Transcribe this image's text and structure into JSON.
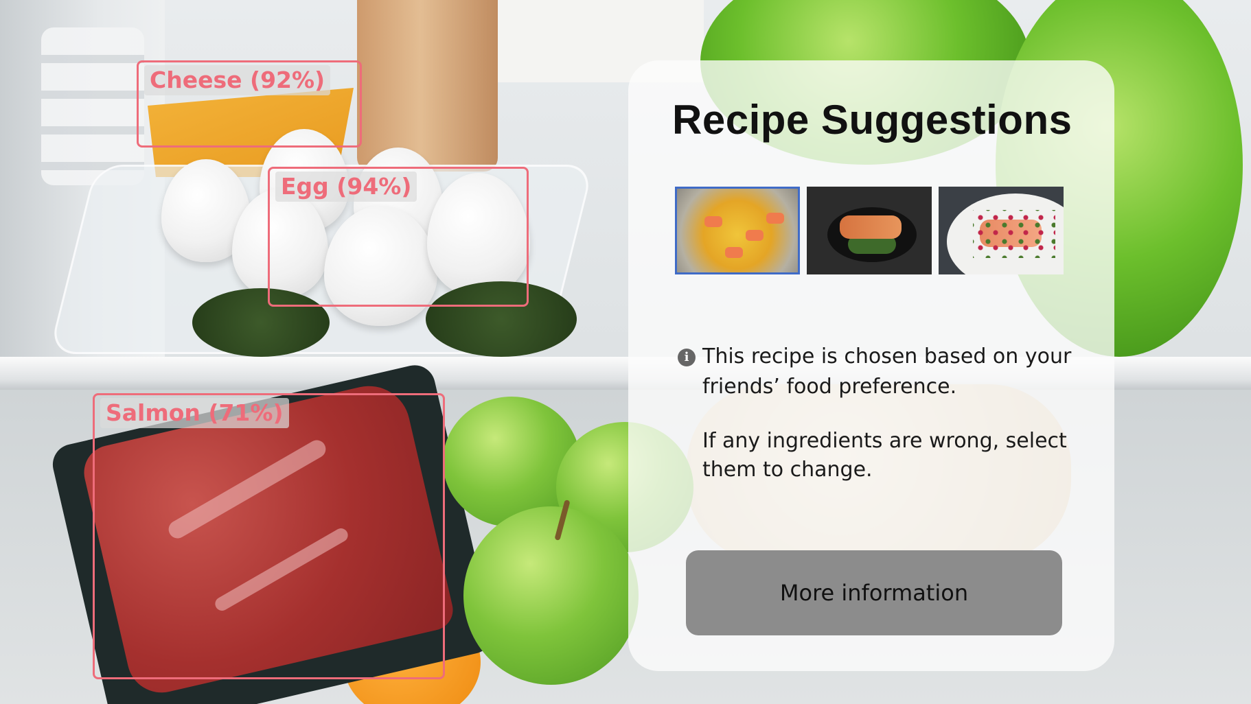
{
  "detections": [
    {
      "label": "Cheese (92%)",
      "color": "#ee6c7a"
    },
    {
      "label": "Egg (94%)",
      "color": "#ee6c7a"
    },
    {
      "label": "Salmon (71%)",
      "color": "#ee6c7a"
    }
  ],
  "panel": {
    "title": "Recipe Suggestions",
    "recipes": [
      {
        "name": "salmon-scrambled-eggs",
        "selected": true
      },
      {
        "name": "salmon-fillet-dark-plate",
        "selected": false
      },
      {
        "name": "salmon-fillet-white-plate",
        "selected": false
      }
    ],
    "info_icon": "info-icon",
    "info_text": "This recipe is chosen based on your friends’ food preference.",
    "hint_text": "If any ingredients are wrong, select them to change.",
    "button_label": "More information"
  },
  "colors": {
    "detection_box": "#ee6c7a",
    "selected_thumb_border": "#3f6bc7",
    "button_bg": "#8c8c8c"
  }
}
